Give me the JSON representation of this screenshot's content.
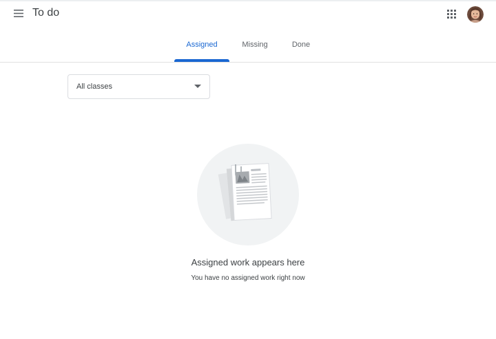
{
  "header": {
    "title": "To do",
    "menu_icon": "hamburger-menu-icon",
    "apps_icon": "google-apps-grid-icon",
    "avatar_icon": "user-avatar"
  },
  "tabs": [
    {
      "label": "Assigned",
      "active": true
    },
    {
      "label": "Missing",
      "active": false
    },
    {
      "label": "Done",
      "active": false
    }
  ],
  "filter": {
    "selected": "All classes",
    "icon": "dropdown-arrow-icon"
  },
  "empty_state": {
    "title": "Assigned work appears here",
    "subtitle": "You have no assigned work right now",
    "illustration": "document-stack-illustration"
  },
  "colors": {
    "accent": "#1967d2",
    "text": "#3c4043",
    "muted": "#5f6368",
    "divider": "#e0e0e0",
    "illustration_bg": "#f1f3f4"
  }
}
